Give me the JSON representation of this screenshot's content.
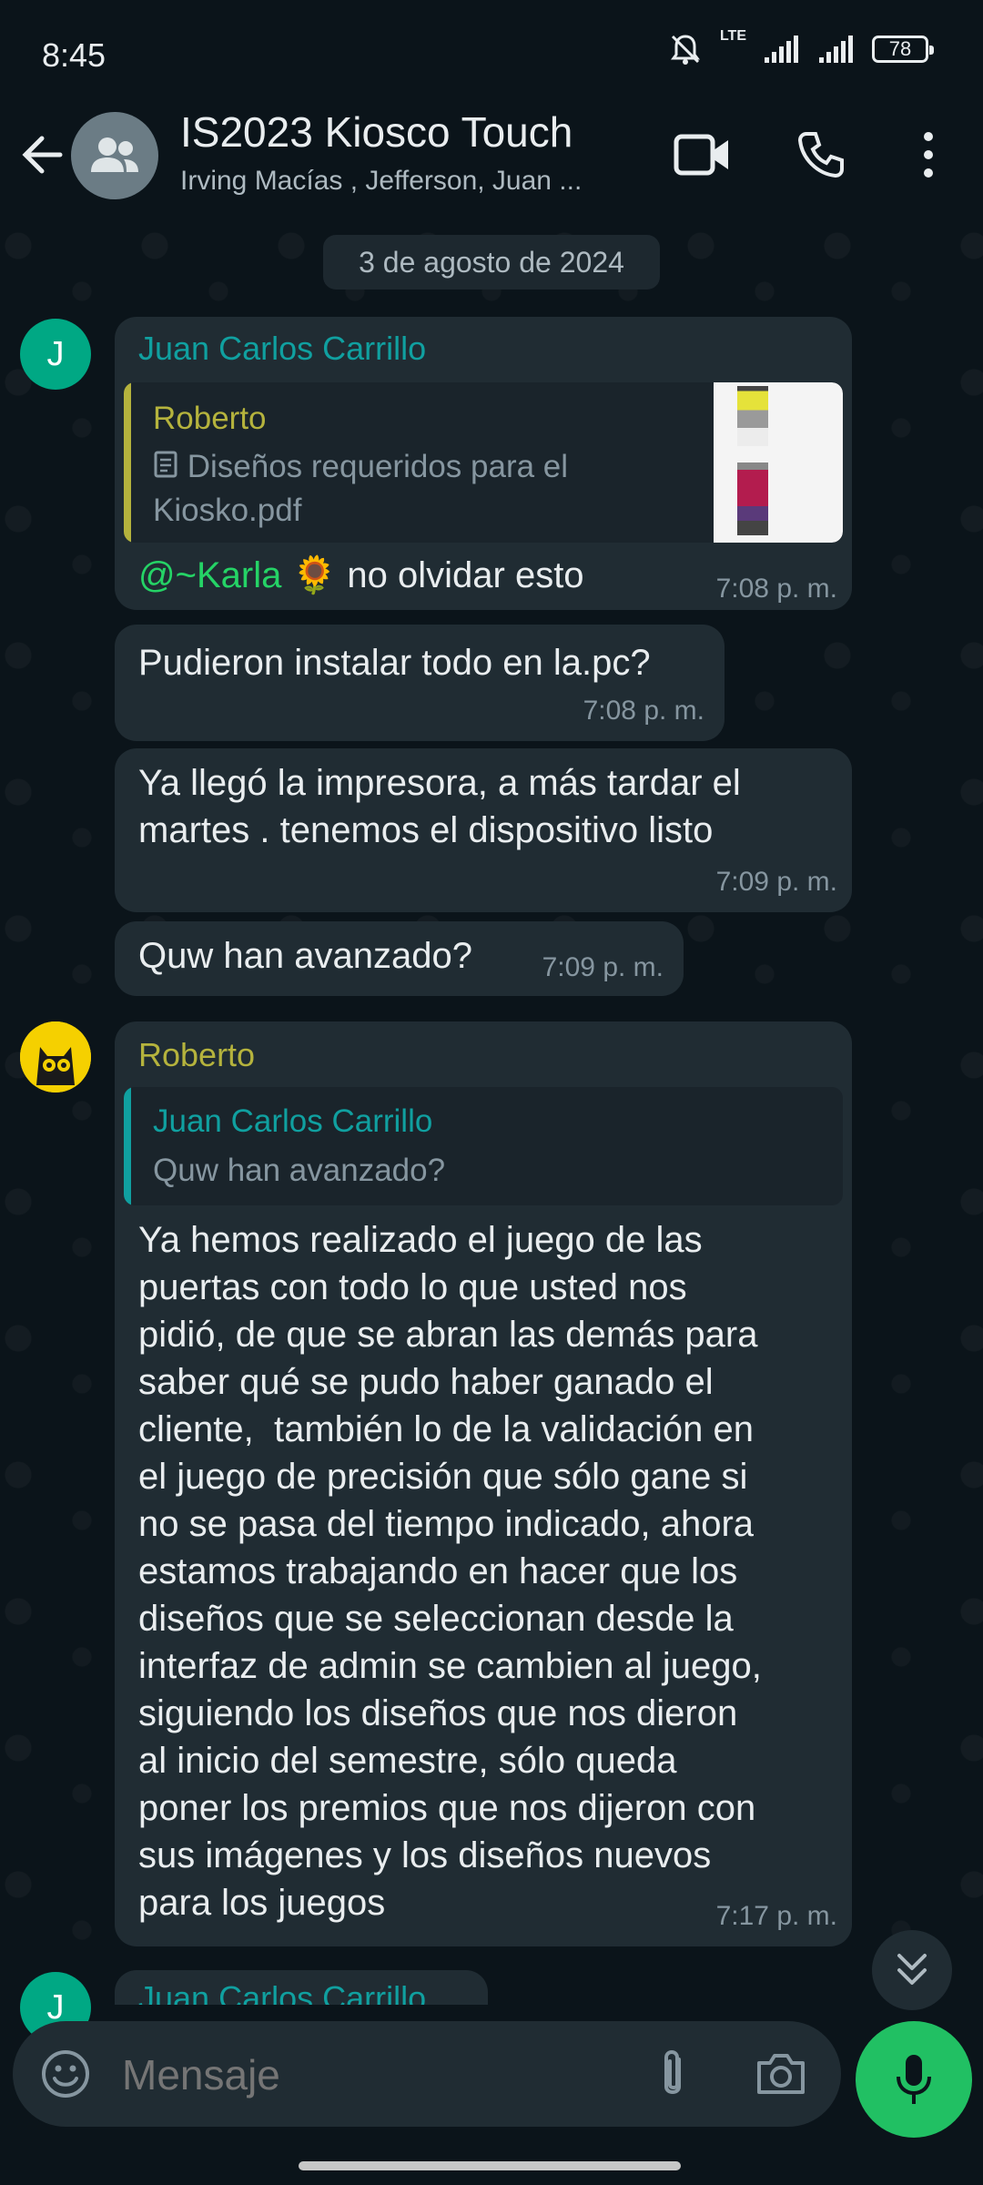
{
  "status_bar": {
    "time": "8:45",
    "network": "LTE",
    "battery": "78"
  },
  "header": {
    "title": "IS2023 Kiosco Touch",
    "subtitle": "Irving Macías , Jefferson, Juan ..."
  },
  "chat": {
    "date_separator": "3 de agosto de 2024",
    "messages": [
      {
        "sender": "Juan Carlos Carrillo",
        "avatar_letter": "J",
        "quote_author": "Roberto",
        "quote_text_line1": "Diseños requeridos para el",
        "quote_text_line2": "Kiosko.pdf",
        "mention": "@~Karla",
        "emoji": "🌻",
        "text": " no olvidar esto",
        "time": "7:08 p. m."
      },
      {
        "text": "Pudieron instalar todo en la.pc?",
        "time": "7:08 p. m."
      },
      {
        "text_line1": "Ya llegó la impresora, a más tardar el",
        "text_line2": "martes . tenemos el dispositivo listo",
        "time": "7:09 p. m."
      },
      {
        "text": "Quw han avanzado?",
        "time": "7:09 p. m."
      },
      {
        "sender": "Roberto",
        "quote_author": "Juan Carlos Carrillo",
        "quote_text": "Quw han avanzado?",
        "lines": [
          "Ya hemos realizado el juego de las",
          "puertas con todo lo que usted nos",
          "pidió, de que se abran las demás para",
          "saber qué se pudo haber ganado el",
          "cliente,  también lo de la validación en",
          "el juego de precisión que sólo gane si",
          "no se pasa del tiempo indicado, ahora",
          "estamos trabajando en hacer que los",
          "diseños que se seleccionan desde la",
          "interfaz de admin se cambien al juego,",
          "siguiendo los diseños que nos dieron",
          "al inicio del semestre, sólo queda",
          "poner los premios que nos dijeron con",
          "sus imágenes y los diseños nuevos",
          "para los juegos"
        ],
        "time": "7:17 p. m."
      },
      {
        "sender": "Juan Carlos Carrillo",
        "avatar_letter": "J"
      }
    ]
  },
  "composer": {
    "placeholder": "Mensaje"
  },
  "colors": {
    "background": "#0b141a",
    "bubble": "#202c33",
    "teal_sender": "#10a0a0",
    "olive_sender": "#b5b33d",
    "mention": "#25d366",
    "mic_button": "#21c063"
  }
}
